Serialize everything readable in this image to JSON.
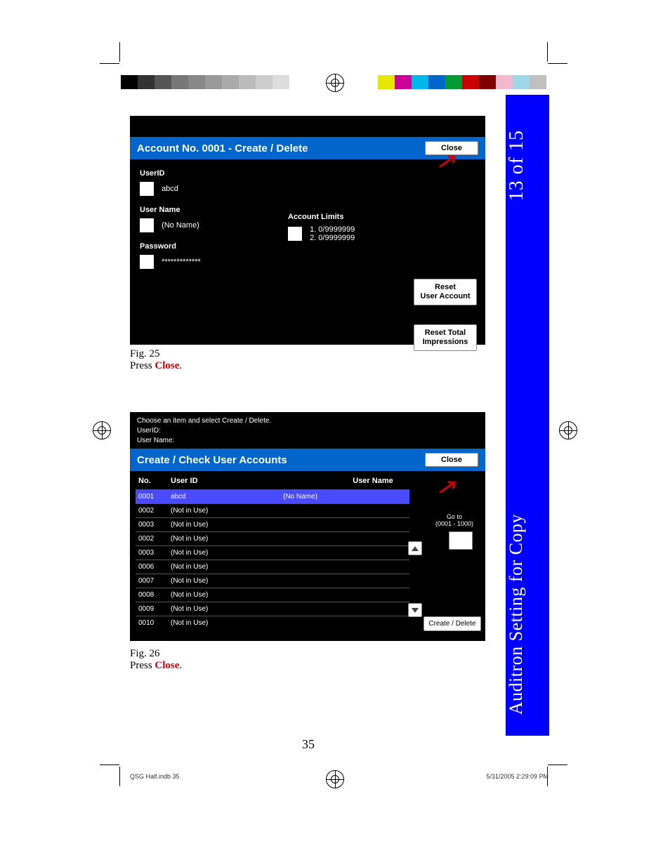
{
  "side_tab": {
    "page_count": "13 of 15",
    "title": "Auditron Setting for Copy"
  },
  "screen1": {
    "title": "Account No. 0001 - Create / Delete",
    "close": "Close",
    "userid_label": "UserID",
    "userid_value": "abcd",
    "username_label": "User Name",
    "username_value": "(No Name)",
    "limits_label": "Account Limits",
    "limits_line1": "1. 0/9999999",
    "limits_line2": "2. 0/9999999",
    "password_label": "Password",
    "password_value": "*************",
    "reset_user": "Reset\nUser Account",
    "reset_total": "Reset Total\nImpressions"
  },
  "caption1": {
    "fig": "Fig. 25",
    "text_pre": "Press ",
    "text_red": "Close",
    "text_post": "."
  },
  "screen2": {
    "prehead_line1": "Choose an item and select Create / Delete.",
    "prehead_line2": "UserID:",
    "prehead_line3": "User Name:",
    "title": "Create / Check User Accounts",
    "close": "Close",
    "col_no": "No.",
    "col_uid": "User ID",
    "col_un": "User Name",
    "rows": [
      {
        "no": "0001",
        "uid": "abcd",
        "un": "(No Name)",
        "selected": true
      },
      {
        "no": "0002",
        "uid": "(Not in Use)",
        "un": "",
        "selected": false
      },
      {
        "no": "0003",
        "uid": "(Not in Use)",
        "un": "",
        "selected": false
      },
      {
        "no": "0002",
        "uid": "(Not in Use)",
        "un": "",
        "selected": false
      },
      {
        "no": "0003",
        "uid": "(Not in Use)",
        "un": "",
        "selected": false
      },
      {
        "no": "0006",
        "uid": "(Not in Use)",
        "un": "",
        "selected": false
      },
      {
        "no": "0007",
        "uid": "(Not in Use)",
        "un": "",
        "selected": false
      },
      {
        "no": "0008",
        "uid": "(Not in Use)",
        "un": "",
        "selected": false
      },
      {
        "no": "0009",
        "uid": "(Not in Use)",
        "un": "",
        "selected": false
      },
      {
        "no": "0010",
        "uid": "(Not in Use)",
        "un": "",
        "selected": false
      }
    ],
    "goto_label": "Go to",
    "goto_range": "(0001 - 1000)",
    "create_delete": "Create / Delete"
  },
  "caption2": {
    "fig": "Fig. 26",
    "text_pre": "Press ",
    "text_red": "Close",
    "text_post": "."
  },
  "page_number": "35",
  "footer": {
    "left": "QSG Half.indb   35",
    "right": "5/31/2005   2:29:09 PM"
  },
  "colorbar_left": [
    "#000",
    "#333",
    "#555",
    "#777",
    "#888",
    "#999",
    "#aaa",
    "#bbb",
    "#ccc",
    "#ddd"
  ],
  "colorbar_right": [
    "#e6e600",
    "#cc0099",
    "#00b7eb",
    "#0066cc",
    "#009933",
    "#cc0000",
    "#800000",
    "#f5b7d0",
    "#9fd6e8",
    "#c0c0c0"
  ]
}
